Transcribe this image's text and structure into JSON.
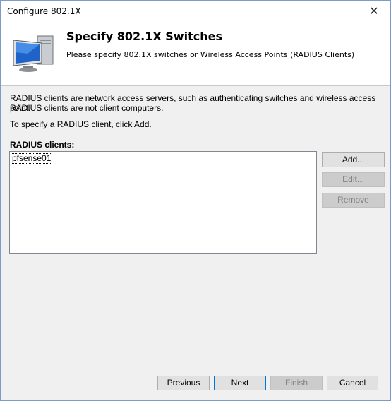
{
  "window": {
    "title": "Configure 802.1X",
    "close_glyph": "✕"
  },
  "header": {
    "title": "Specify 802.1X Switches",
    "subtitle": "Please specify 802.1X switches or Wireless Access Points (RADIUS Clients)",
    "icon": "monitor-icon"
  },
  "description": {
    "line1": "RADIUS clients are network access servers, such as authenticating switches and wireless access point.",
    "line2": "RADIUS clients are not client computers.",
    "line3": "To specify a RADIUS client, click Add."
  },
  "radius": {
    "label": "RADIUS clients:",
    "items": [
      "pfsense01"
    ]
  },
  "side_buttons": {
    "add": "Add...",
    "edit": "Edit...",
    "remove": "Remove"
  },
  "footer": {
    "previous": "Previous",
    "next": "Next",
    "finish": "Finish",
    "cancel": "Cancel"
  },
  "colors": {
    "window_border": "#7a9cc6",
    "dialog_bg": "#f0f0f0",
    "default_button_border": "#0078d7"
  }
}
